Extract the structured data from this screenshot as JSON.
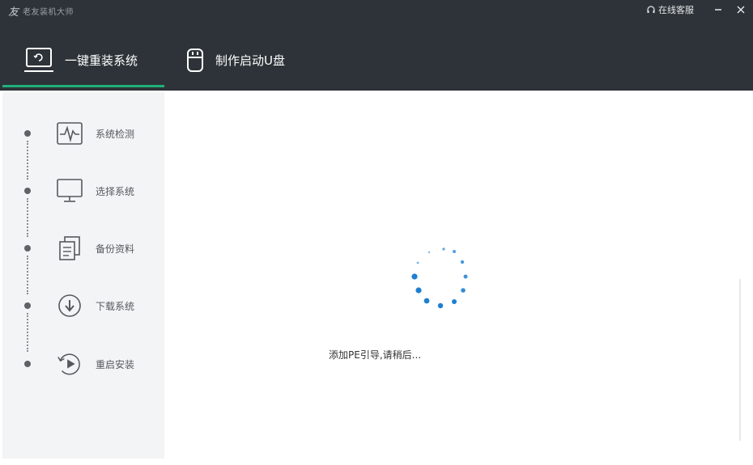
{
  "window": {
    "title": "老友装机大师",
    "online_service": "在线客服"
  },
  "tabs": [
    {
      "label": "一键重装系统",
      "icon": "monitor-refresh-icon",
      "active": true
    },
    {
      "label": "制作启动U盘",
      "icon": "usb-drive-icon",
      "active": false
    }
  ],
  "steps": [
    {
      "label": "系统检测",
      "icon": "pulse-monitor-icon"
    },
    {
      "label": "选择系统",
      "icon": "desktop-monitor-icon"
    },
    {
      "label": "备份资料",
      "icon": "documents-icon"
    },
    {
      "label": "下载系统",
      "icon": "download-arrow-icon"
    },
    {
      "label": "重启安装",
      "icon": "restart-play-icon"
    }
  ],
  "main": {
    "status_text": "添加PE引导,请稍后..."
  },
  "colors": {
    "header_bg": "#2d3338",
    "accent_green": "#21b07a",
    "spinner_blue": "#1e7fd0",
    "sidebar_bg": "#f3f4f5"
  }
}
